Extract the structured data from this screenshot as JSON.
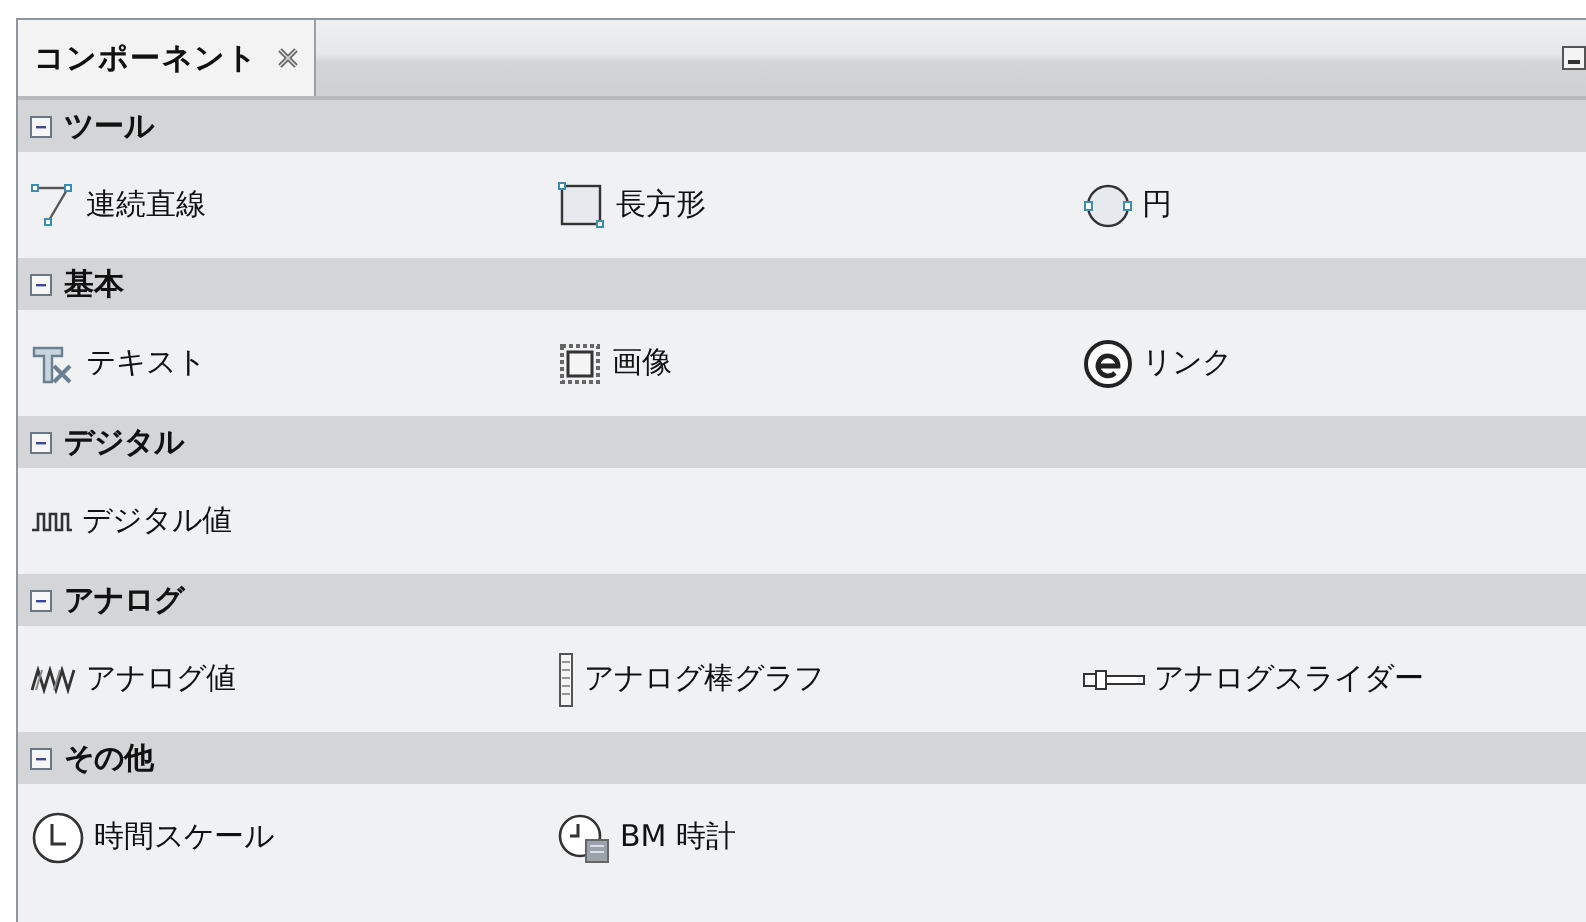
{
  "tab": {
    "title": "コンポーネント",
    "selected": true
  },
  "sections": [
    {
      "title": "ツール",
      "expanded": true,
      "items": [
        {
          "kind": "polyline",
          "label": "連続直線"
        },
        {
          "kind": "rectangle",
          "label": "長方形"
        },
        {
          "kind": "circle",
          "label": "円"
        }
      ]
    },
    {
      "title": "基本",
      "expanded": true,
      "items": [
        {
          "kind": "text",
          "label": "テキスト"
        },
        {
          "kind": "image",
          "label": "画像"
        },
        {
          "kind": "link",
          "label": "リンク"
        }
      ]
    },
    {
      "title": "デジタル",
      "expanded": true,
      "items": [
        {
          "kind": "digital",
          "label": "デジタル値"
        }
      ]
    },
    {
      "title": "アナログ",
      "expanded": true,
      "items": [
        {
          "kind": "analog",
          "label": "アナログ値"
        },
        {
          "kind": "bargraph",
          "label": "アナログ棒グラフ"
        },
        {
          "kind": "slider",
          "label": "アナログスライダー"
        }
      ]
    },
    {
      "title": "その他",
      "expanded": true,
      "items": [
        {
          "kind": "timescale",
          "label": "時間スケール"
        },
        {
          "kind": "clock",
          "label": "BM 時計"
        }
      ]
    }
  ]
}
